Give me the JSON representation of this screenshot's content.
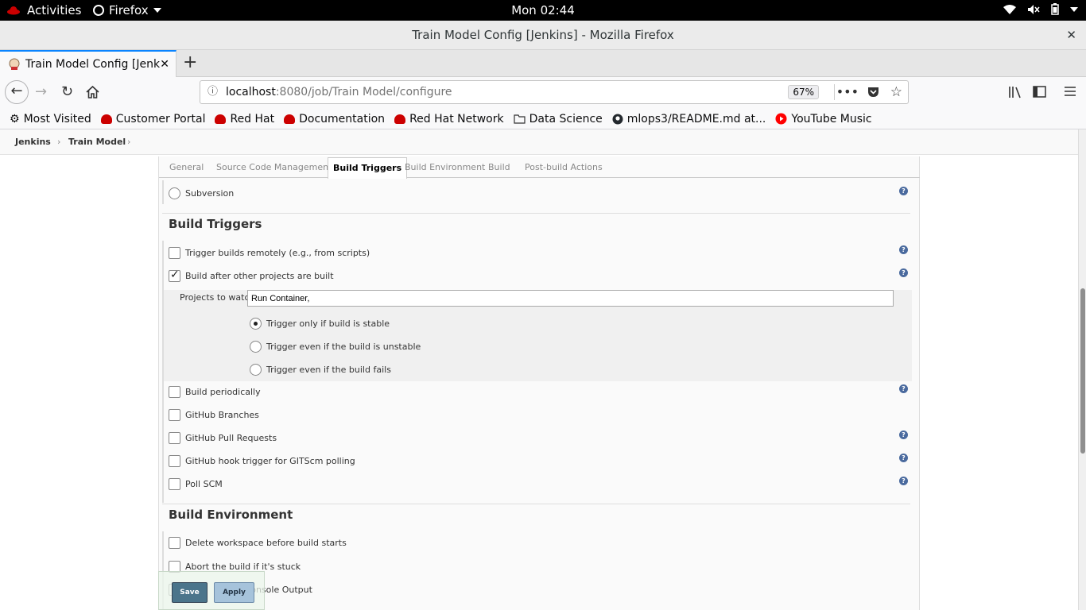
{
  "gnome": {
    "activities": "Activities",
    "app_name": "Firefox",
    "clock": "Mon 02:44"
  },
  "window": {
    "title": "Train Model Config [Jenkins] - Mozilla Firefox",
    "close_glyph": "✕"
  },
  "tab": {
    "title": "Train Model Config [Jenkins]",
    "close_glyph": "✕"
  },
  "nav": {
    "url_host": "localhost",
    "url_rest": ":8080/job/Train Model/configure",
    "zoom": "67%"
  },
  "bookmarks": [
    {
      "label": "Most Visited",
      "icon": "gear-icon"
    },
    {
      "label": "Customer Portal",
      "icon": "redhat-icon"
    },
    {
      "label": "Red Hat",
      "icon": "redhat-icon"
    },
    {
      "label": "Documentation",
      "icon": "redhat-icon"
    },
    {
      "label": "Red Hat Network",
      "icon": "redhat-icon"
    },
    {
      "label": "Data Science",
      "icon": "folder-icon"
    },
    {
      "label": "mlops3/README.md at...",
      "icon": "github-icon"
    },
    {
      "label": "YouTube Music",
      "icon": "youtube-music-icon"
    }
  ],
  "breadcrumb": {
    "jenkins": "Jenkins",
    "job": "Train Model",
    "sep": "›"
  },
  "config_tabs": [
    {
      "label": "General",
      "active": false
    },
    {
      "label": "Source Code Management",
      "active": false
    },
    {
      "label": "Build Triggers",
      "active": true
    },
    {
      "label": "Build Environment",
      "active": false
    },
    {
      "label": "Build",
      "active": false
    },
    {
      "label": "Post-build Actions",
      "active": false
    }
  ],
  "scm": {
    "subversion": "Subversion"
  },
  "build_triggers": {
    "title": "Build Triggers",
    "remote": "Trigger builds remotely (e.g., from scripts)",
    "after_other": "Build after other projects are built",
    "projects_label": "Projects to watch",
    "projects_value": "Run Container,",
    "opt_stable": "Trigger only if build is stable",
    "opt_unstable": "Trigger even if the build is unstable",
    "opt_fails": "Trigger even if the build fails",
    "periodic": "Build periodically",
    "gh_branches": "GitHub Branches",
    "gh_prs": "GitHub Pull Requests",
    "gh_hook": "GitHub hook trigger for GITScm polling",
    "poll_scm": "Poll SCM"
  },
  "build_env": {
    "title": "Build Environment",
    "delete_ws": "Delete workspace before build starts",
    "abort": "Abort the build if it's stuck",
    "console_partial": "the Console Output"
  },
  "buttons": {
    "save": "Save",
    "apply": "Apply"
  },
  "help_glyph": "?"
}
